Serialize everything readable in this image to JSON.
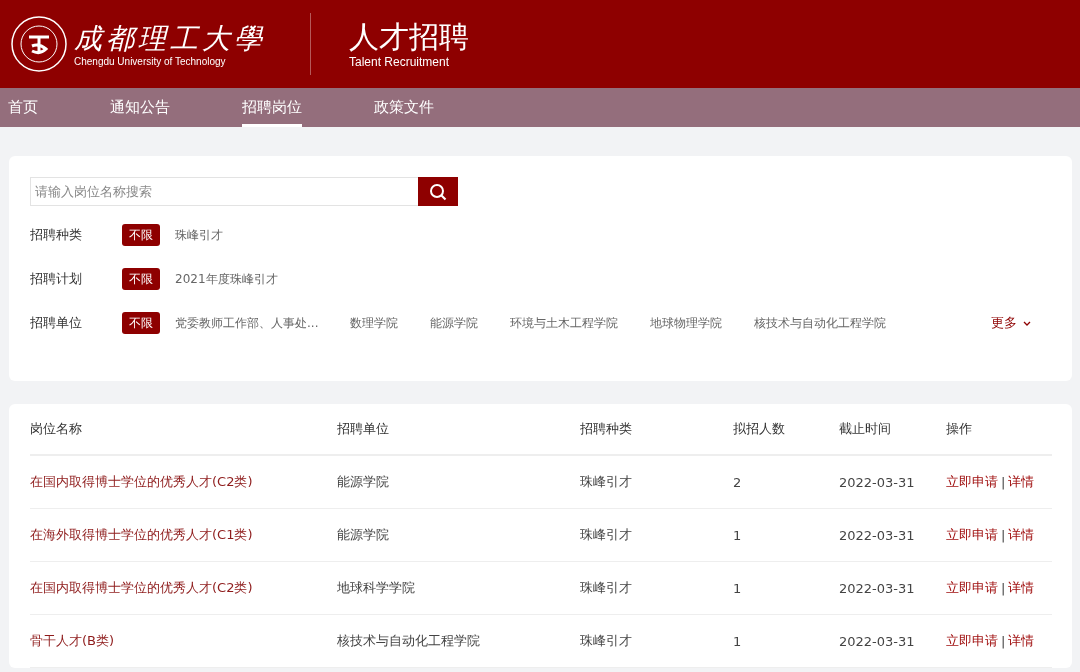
{
  "header": {
    "logo_cn": "成都理工大學",
    "logo_en": "Chengdu University of Technology",
    "title": "人才招聘",
    "subtitle": "Talent Recruitment"
  },
  "nav": [
    {
      "label": "首页",
      "selected": false
    },
    {
      "label": "通知公告",
      "selected": false
    },
    {
      "label": "招聘岗位",
      "selected": true
    },
    {
      "label": "政策文件",
      "selected": false
    }
  ],
  "search": {
    "placeholder": "请输入岗位名称搜索"
  },
  "filters": [
    {
      "label": "招聘种类",
      "options": [
        {
          "label": "不限",
          "selected": true
        },
        {
          "label": "珠峰引才",
          "selected": false
        }
      ]
    },
    {
      "label": "招聘计划",
      "options": [
        {
          "label": "不限",
          "selected": true
        },
        {
          "label": "2021年度珠峰引才",
          "selected": false
        }
      ]
    },
    {
      "label": "招聘单位",
      "more": "更多",
      "options": [
        {
          "label": "不限",
          "selected": true
        },
        {
          "label": "党委教师工作部、人事处...",
          "selected": false
        },
        {
          "label": "数理学院",
          "selected": false
        },
        {
          "label": "能源学院",
          "selected": false
        },
        {
          "label": "环境与土木工程学院",
          "selected": false
        },
        {
          "label": "地球物理学院",
          "selected": false
        },
        {
          "label": "核技术与自动化工程学院",
          "selected": false
        }
      ]
    }
  ],
  "table": {
    "columns": [
      "岗位名称",
      "招聘单位",
      "招聘种类",
      "拟招人数",
      "截止时间",
      "操作"
    ],
    "rows": [
      {
        "name": "在国内取得博士学位的优秀人才(C2类)",
        "unit": "能源学院",
        "type": "珠峰引才",
        "count": "2",
        "deadline": "2022-03-31",
        "apply": "立即申请",
        "sep": "|",
        "detail": "详情"
      },
      {
        "name": "在海外取得博士学位的优秀人才(C1类)",
        "unit": "能源学院",
        "type": "珠峰引才",
        "count": "1",
        "deadline": "2022-03-31",
        "apply": "立即申请",
        "sep": "|",
        "detail": "详情"
      },
      {
        "name": "在国内取得博士学位的优秀人才(C2类)",
        "unit": "地球科学学院",
        "type": "珠峰引才",
        "count": "1",
        "deadline": "2022-03-31",
        "apply": "立即申请",
        "sep": "|",
        "detail": "详情"
      },
      {
        "name": "骨干人才(B类)",
        "unit": "核技术与自动化工程学院",
        "type": "珠峰引才",
        "count": "1",
        "deadline": "2022-03-31",
        "apply": "立即申请",
        "sep": "|",
        "detail": "详情"
      }
    ]
  }
}
